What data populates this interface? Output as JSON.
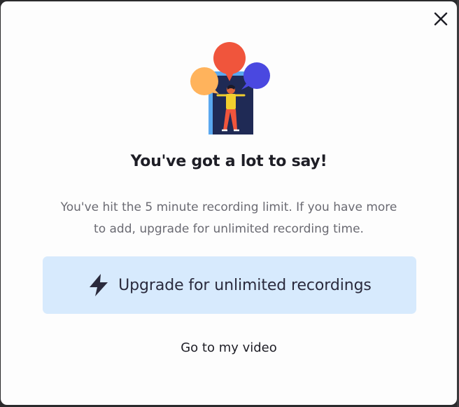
{
  "dialog": {
    "close_icon": "close-icon",
    "illustration_icon": "person-speech-bubbles-illustration",
    "headline": "You've got a lot to say!",
    "description_line1": "You've hit the 5 minute recording limit. If you have more",
    "description_line2": "to add, upgrade for unlimited recording time.",
    "upgrade_button": {
      "icon": "lightning-bolt-icon",
      "label": "Upgrade for unlimited recordings"
    },
    "secondary_link": "Go to my video"
  },
  "colors": {
    "modal_background": "#fdfdfd",
    "upgrade_button_background": "#d7eafd",
    "bubble_red": "#f0553c",
    "bubble_orange": "#ffb35c",
    "bubble_blue": "#4a48e0",
    "panel_blue": "#5aa8f0",
    "panel_dark": "#1f2a55",
    "text_primary": "#1e1e26",
    "text_secondary": "#6a6a72"
  }
}
